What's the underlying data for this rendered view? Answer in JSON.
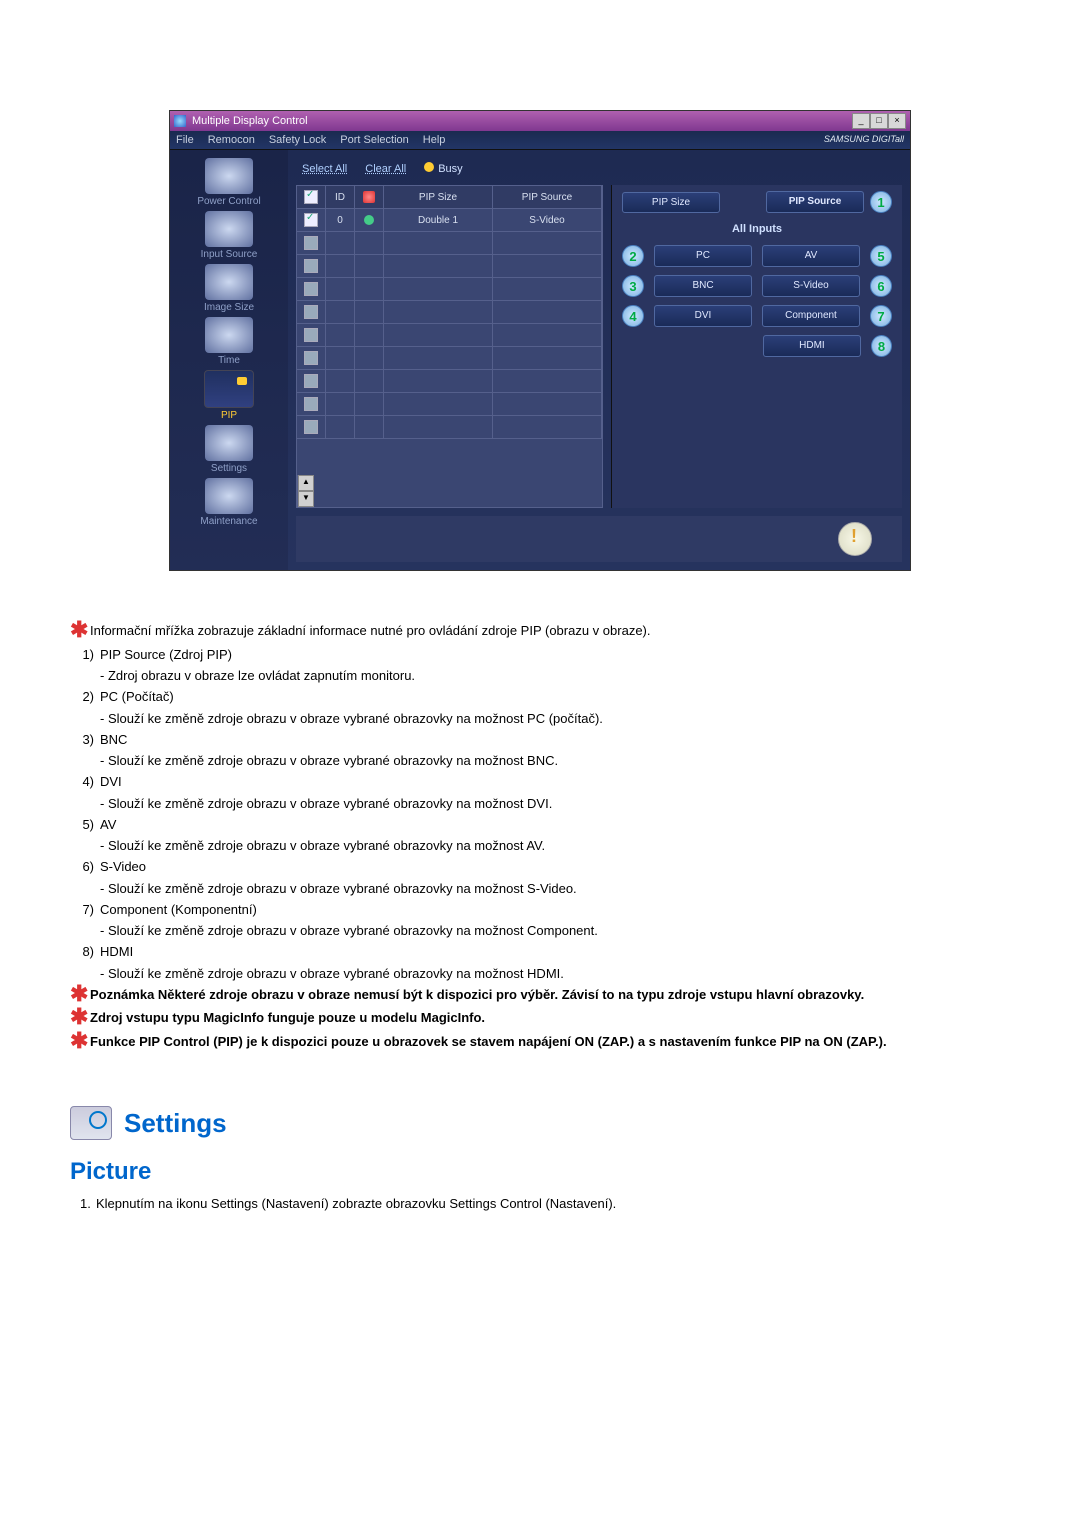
{
  "titlebar": {
    "text": "Multiple Display Control"
  },
  "menubar": {
    "file": "File",
    "remocon": "Remocon",
    "safety": "Safety Lock",
    "port": "Port Selection",
    "help": "Help",
    "brand": "SAMSUNG DIGITall"
  },
  "sidebar": {
    "power": "Power Control",
    "input": "Input Source",
    "image": "Image Size",
    "time": "Time",
    "pip": "PIP",
    "settings": "Settings",
    "maintenance": "Maintenance"
  },
  "topbuttons": {
    "select": "Select All",
    "clear": "Clear All",
    "busy": "Busy"
  },
  "grid": {
    "h_chk": "",
    "h_id": "ID",
    "h_status": "",
    "h_size": "PIP Size",
    "h_src": "PIP Source",
    "row0_id": "0",
    "row0_size": "Double 1",
    "row0_src": "S-Video"
  },
  "panel": {
    "pip_size": "PIP Size",
    "pip_source": "PIP Source",
    "all_inputs": "All Inputs",
    "pc": "PC",
    "av": "AV",
    "bnc": "BNC",
    "svideo": "S-Video",
    "dvi": "DVI",
    "component": "Component",
    "hdmi": "HDMI",
    "n1": "1",
    "n2": "2",
    "n3": "3",
    "n4": "4",
    "n5": "5",
    "n6": "6",
    "n7": "7",
    "n8": "8"
  },
  "doc": {
    "l_star1": "Informační mřížka zobrazuje základní informace nutné pro ovládání zdroje PIP (obrazu v obraze).",
    "l1n": "1)",
    "l1t": "PIP Source (Zdroj PIP)",
    "l1d": "- Zdroj obrazu v obraze lze ovládat zapnutím monitoru.",
    "l2n": "2)",
    "l2t": "PC (Počítač)",
    "l2d": "- Slouží ke změně zdroje obrazu v obraze vybrané obrazovky na možnost PC (počítač).",
    "l3n": "3)",
    "l3t": "BNC",
    "l3d": "- Slouží ke změně zdroje obrazu v obraze vybrané obrazovky na možnost BNC.",
    "l4n": "4)",
    "l4t": "DVI",
    "l4d": "- Slouží ke změně zdroje obrazu v obraze vybrané obrazovky na možnost DVI.",
    "l5n": "5)",
    "l5t": "AV",
    "l5d": "- Slouží ke změně zdroje obrazu v obraze vybrané obrazovky na možnost AV.",
    "l6n": "6)",
    "l6t": "S-Video",
    "l6d": "- Slouží ke změně zdroje obrazu v obraze vybrané obrazovky na možnost S-Video.",
    "l7n": "7)",
    "l7t": "Component (Komponentní)",
    "l7d": "- Slouží ke změně zdroje obrazu v obraze vybrané obrazovky na možnost Component.",
    "l8n": "8)",
    "l8t": "HDMI",
    "l8d": "- Slouží ke změně zdroje obrazu v obraze vybrané obrazovky na možnost HDMI.",
    "star2": "Poznámka Některé zdroje obrazu v obraze nemusí být k dispozici pro výběr. Závisí to na typu zdroje vstupu hlavní obrazovky.",
    "star3": "Zdroj vstupu typu MagicInfo funguje pouze u modelu MagicInfo.",
    "star4": "Funkce PIP Control (PIP) je k dispozici pouze u obrazovek se stavem napájení ON (ZAP.) a s nastavením funkce PIP na ON (ZAP.).",
    "settings_title": "Settings",
    "picture_title": "Picture",
    "pic_l1n": "1.",
    "pic_l1": "Klepnutím na ikonu Settings (Nastavení) zobrazte obrazovku Settings Control (Nastavení)."
  }
}
